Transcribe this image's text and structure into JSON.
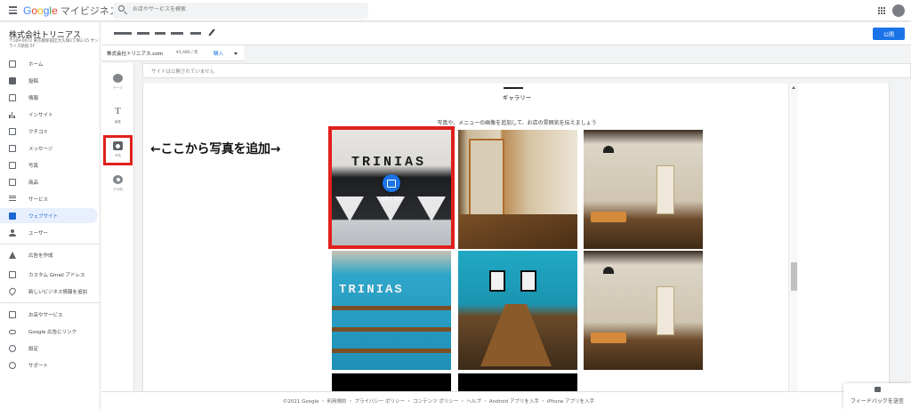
{
  "app": {
    "logo_google": [
      "G",
      "o",
      "o",
      "g",
      "l",
      "e"
    ],
    "product": "マイビジネス",
    "search_placeholder": "お店やサービスを検索"
  },
  "business": {
    "name": "株式会社トリニアス",
    "address": "〒169-0072 東京都新宿区大久保2丁目2-15 サンライズ新宿 5F"
  },
  "sidebar": {
    "items": [
      {
        "label": "ホーム",
        "icon": "home-icon"
      },
      {
        "label": "投稿",
        "icon": "post-icon"
      },
      {
        "label": "情報",
        "icon": "store-icon"
      },
      {
        "label": "インサイト",
        "icon": "insights-icon"
      },
      {
        "label": "クチコミ",
        "icon": "reviews-icon"
      },
      {
        "label": "メッセージ",
        "icon": "messages-icon"
      },
      {
        "label": "写真",
        "icon": "photos-icon"
      },
      {
        "label": "商品",
        "icon": "products-icon"
      },
      {
        "label": "サービス",
        "icon": "services-icon"
      },
      {
        "label": "ウェブサイト",
        "icon": "website-icon",
        "active": true
      },
      {
        "label": "ユーザー",
        "icon": "add-user-icon"
      },
      {
        "label": "広告を作成",
        "icon": "ads-icon"
      },
      {
        "label": "カスタム Gmail アドレス",
        "icon": "gmail-icon"
      },
      {
        "label": "新しいビジネス情報を追加",
        "icon": "location-icon"
      },
      {
        "label": "お店やサービス",
        "icon": "businesses-icon"
      },
      {
        "label": "Google 広告にリンク",
        "icon": "link-icon"
      },
      {
        "label": "設定",
        "icon": "settings-icon"
      },
      {
        "label": "サポート",
        "icon": "help-icon"
      }
    ]
  },
  "header": {
    "publish_label": "公開",
    "pencil_icon": "edit-icon"
  },
  "domain": {
    "name": "株式会社トリニアス.com",
    "price": "¥1,480 / 年",
    "buy_label": "購入"
  },
  "notice": "サイトは公開されていません",
  "tools": [
    {
      "label": "テーマ",
      "icon": "palette-icon"
    },
    {
      "label": "編集",
      "icon": "text-icon"
    },
    {
      "label": "写真",
      "icon": "camera-icon"
    },
    {
      "label": "その他",
      "icon": "gear-icon"
    }
  ],
  "gallery": {
    "title": "ギャラリー",
    "description": "写真や、メニューの画像を追加して、お店の雰囲気を伝えましょう",
    "add_image_label": "画像を追加",
    "sign_text": "TRINIAS"
  },
  "annotation": "←ここから写真を追加→",
  "footer": "©2021 Google ・ 利用規約 ・ プライバシー ポリシー ・ コンテンツ ポリシー ・ ヘルプ ・ Android アプリを入手 ・ iPhone アプリを入手",
  "feedback_label": "フィードバックを送信",
  "colors": {
    "accent": "#1a73e8",
    "highlight_red": "#e0201c",
    "active_bg": "#e8f0fe"
  }
}
